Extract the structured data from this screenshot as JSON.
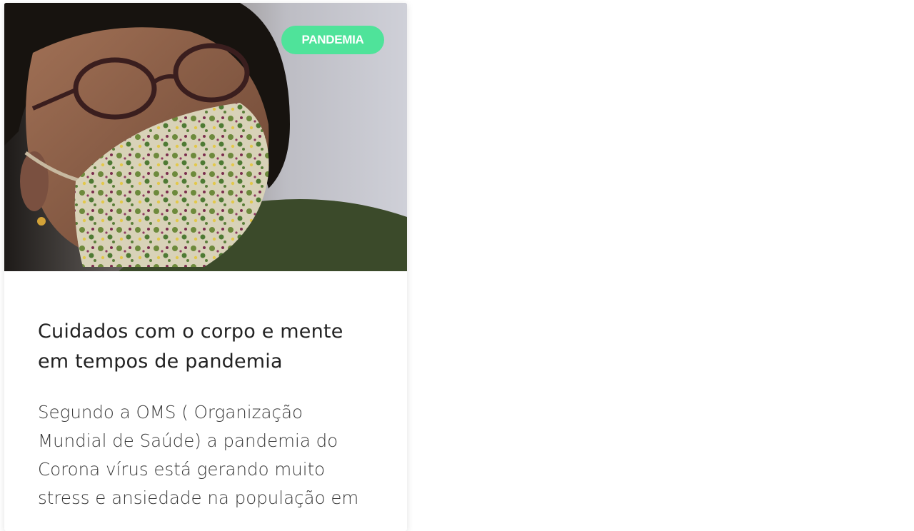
{
  "article_card": {
    "image_alt": "Mulher usando máscara de tecido florida e óculos",
    "badge": {
      "label": "PANDEMIA",
      "color": "#4fe39a"
    },
    "title": "Cuidados com o corpo e mente em tempos de pandemia",
    "excerpt": "Segundo a OMS ( Organização Mundial de Saúde) a pandemia do Corona vírus está gerando muito stress e ansiedade na população em"
  }
}
